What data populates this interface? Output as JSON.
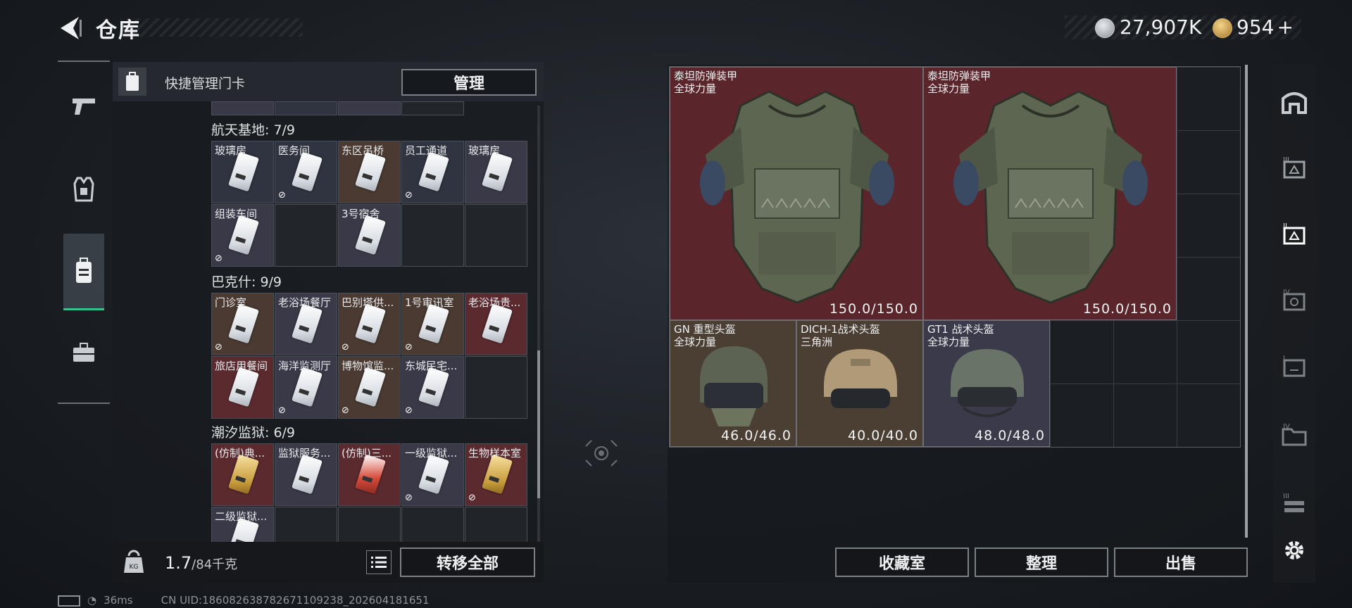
{
  "header": {
    "title": "仓库",
    "silver": "27,907K",
    "gold": "954",
    "gold_add": "+"
  },
  "quick_manage": {
    "label": "快捷管理门卡",
    "manage_button": "管理"
  },
  "sections": [
    {
      "label": "航天基地: 7/9",
      "items": [
        {
          "name": "玻璃房",
          "bg": "blue",
          "restricted": false
        },
        {
          "name": "医务间",
          "bg": "blue",
          "restricted": true
        },
        {
          "name": "东区吊桥",
          "bg": "brown",
          "restricted": false
        },
        {
          "name": "员工通道",
          "bg": "blue",
          "restricted": true
        },
        {
          "name": "玻璃房",
          "bg": "purple",
          "restricted": false
        },
        {
          "name": "组装车间",
          "bg": "purple",
          "restricted": true
        },
        {
          "name": "",
          "bg": "empty",
          "restricted": false
        },
        {
          "name": "3号宿舍",
          "bg": "purple",
          "restricted": false
        }
      ]
    },
    {
      "label": "巴克什: 9/9",
      "items": [
        {
          "name": "门诊室",
          "bg": "brown",
          "restricted": true
        },
        {
          "name": "老浴场餐厅",
          "bg": "purple",
          "restricted": false
        },
        {
          "name": "巴别塔供...",
          "bg": "brown",
          "restricted": true
        },
        {
          "name": "1号审讯室",
          "bg": "brown",
          "restricted": true
        },
        {
          "name": "老浴场贵...",
          "bg": "red",
          "restricted": false
        },
        {
          "name": "旅店用餐间",
          "bg": "red",
          "restricted": false
        },
        {
          "name": "海洋监测厅",
          "bg": "purple",
          "restricted": true
        },
        {
          "name": "博物馆监...",
          "bg": "brown",
          "restricted": true
        },
        {
          "name": "东城民宅...",
          "bg": "purple",
          "restricted": true
        }
      ]
    },
    {
      "label": "潮汐监狱: 6/9",
      "items": [
        {
          "name": "(仿制)典...",
          "bg": "red",
          "restricted": false,
          "card": "gold"
        },
        {
          "name": "监狱服务...",
          "bg": "purple",
          "restricted": false
        },
        {
          "name": "(仿制)三...",
          "bg": "red",
          "restricted": false,
          "card": "red"
        },
        {
          "name": "一级监狱...",
          "bg": "purple",
          "restricted": true
        },
        {
          "name": "生物样本室",
          "bg": "red",
          "restricted": true,
          "card": "gold"
        },
        {
          "name": "二级监狱...",
          "bg": "purple",
          "restricted": false
        }
      ]
    }
  ],
  "weight": {
    "current": "1.7",
    "max": "/84千克"
  },
  "transfer_all": "转移全部",
  "stash_items": [
    {
      "name": "泰坦防弹装甲",
      "sub": "全球力量",
      "durability": "150.0/150.0",
      "kind": "armor"
    },
    {
      "name": "泰坦防弹装甲",
      "sub": "全球力量",
      "durability": "150.0/150.0",
      "kind": "armor"
    },
    {
      "name": "GN 重型头盔",
      "sub": "全球力量",
      "durability": "46.0/46.0",
      "kind": "helmet-gn"
    },
    {
      "name": "DICH-1战术头盔",
      "sub": "三角洲",
      "durability": "40.0/40.0",
      "kind": "helmet-dich"
    },
    {
      "name": "GT1 战术头盔",
      "sub": "全球力量",
      "durability": "48.0/48.0",
      "kind": "helmet-gt1"
    }
  ],
  "bottom_buttons": {
    "collection": "收藏室",
    "organize": "整理",
    "sell": "出售"
  },
  "status": {
    "ping": "36ms",
    "uid": "CN UID:186082638782671109238_202604181651"
  },
  "colors": {
    "accent": "#36c08a",
    "armor_bg": "#5a262b"
  }
}
